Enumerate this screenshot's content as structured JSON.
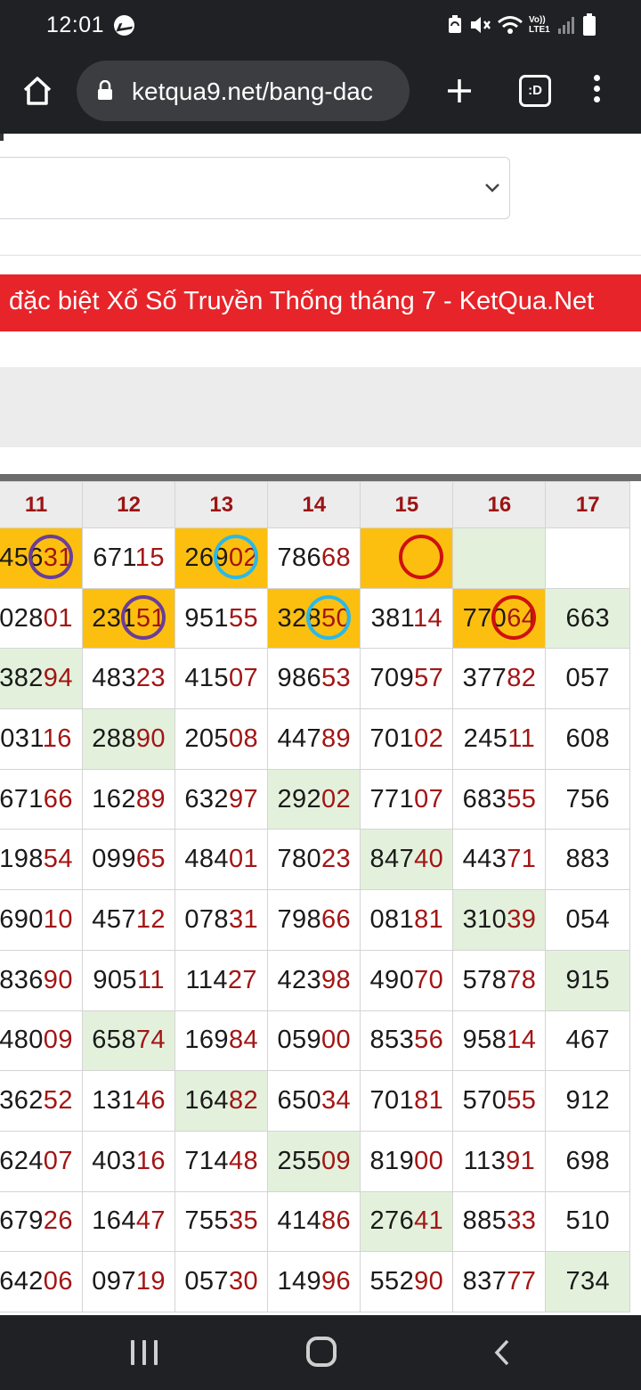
{
  "status_bar": {
    "time": "12:01",
    "volte_label": "Vo)) LTE1",
    "icons": [
      "messenger-icon",
      "sync-icon",
      "mute-icon",
      "wifi-icon",
      "signal-icon",
      "battery-icon"
    ]
  },
  "browser": {
    "url": "ketqua9.net/bang-dac",
    "tab_count_label": ":D",
    "icons": [
      "home-icon",
      "lock-icon",
      "plus-icon",
      "tabs-icon",
      "more-vert-icon"
    ]
  },
  "page": {
    "title": "đặc biệt Xổ Số Truyền Thống tháng 7 - KetQua.Net",
    "colors": {
      "banner": "#e62429",
      "highlight_orange": "#fcbf10",
      "highlight_green": "#e3f1dc",
      "tail_digits": "#a31515",
      "ring_purple": "#6a3d9a",
      "ring_cyan": "#29b9e8",
      "ring_red": "#cf1010"
    }
  },
  "table": {
    "headers": [
      "11",
      "12",
      "13",
      "14",
      "15",
      "16",
      "17"
    ],
    "rows": [
      [
        {
          "head": "456",
          "tail": "31",
          "hl": "orange",
          "ring": "purple"
        },
        {
          "head": "671",
          "tail": "15",
          "hl": "white",
          "ring": ""
        },
        {
          "head": "269",
          "tail": "02",
          "hl": "orange",
          "ring": "cyan"
        },
        {
          "head": "786",
          "tail": "68",
          "hl": "white",
          "ring": ""
        },
        {
          "head": "",
          "tail": "",
          "hl": "orange",
          "ring": "red"
        },
        {
          "head": "",
          "tail": "",
          "hl": "green",
          "ring": ""
        },
        {
          "head": "",
          "tail": "",
          "hl": "white",
          "ring": ""
        }
      ],
      [
        {
          "head": "028",
          "tail": "01",
          "hl": "",
          "ring": ""
        },
        {
          "head": "231",
          "tail": "51",
          "hl": "orange",
          "ring": "purple"
        },
        {
          "head": "951",
          "tail": "55",
          "hl": "",
          "ring": ""
        },
        {
          "head": "328",
          "tail": "50",
          "hl": "orange",
          "ring": "cyan"
        },
        {
          "head": "381",
          "tail": "14",
          "hl": "",
          "ring": ""
        },
        {
          "head": "770",
          "tail": "64",
          "hl": "orange",
          "ring": "red"
        },
        {
          "head": "663",
          "tail": "",
          "hl": "green",
          "ring": ""
        }
      ],
      [
        {
          "head": "382",
          "tail": "94",
          "hl": "green",
          "ring": ""
        },
        {
          "head": "483",
          "tail": "23",
          "hl": "",
          "ring": ""
        },
        {
          "head": "415",
          "tail": "07",
          "hl": "",
          "ring": ""
        },
        {
          "head": "986",
          "tail": "53",
          "hl": "",
          "ring": ""
        },
        {
          "head": "709",
          "tail": "57",
          "hl": "",
          "ring": ""
        },
        {
          "head": "377",
          "tail": "82",
          "hl": "",
          "ring": ""
        },
        {
          "head": "057",
          "tail": "",
          "hl": "",
          "ring": ""
        }
      ],
      [
        {
          "head": "031",
          "tail": "16",
          "hl": "",
          "ring": ""
        },
        {
          "head": "288",
          "tail": "90",
          "hl": "green",
          "ring": ""
        },
        {
          "head": "205",
          "tail": "08",
          "hl": "",
          "ring": ""
        },
        {
          "head": "447",
          "tail": "89",
          "hl": "",
          "ring": ""
        },
        {
          "head": "701",
          "tail": "02",
          "hl": "",
          "ring": ""
        },
        {
          "head": "245",
          "tail": "11",
          "hl": "",
          "ring": ""
        },
        {
          "head": "608",
          "tail": "",
          "hl": "",
          "ring": ""
        }
      ],
      [
        {
          "head": "671",
          "tail": "66",
          "hl": "",
          "ring": ""
        },
        {
          "head": "162",
          "tail": "89",
          "hl": "",
          "ring": ""
        },
        {
          "head": "632",
          "tail": "97",
          "hl": "",
          "ring": ""
        },
        {
          "head": "292",
          "tail": "02",
          "hl": "green",
          "ring": ""
        },
        {
          "head": "771",
          "tail": "07",
          "hl": "",
          "ring": ""
        },
        {
          "head": "683",
          "tail": "55",
          "hl": "",
          "ring": ""
        },
        {
          "head": "756",
          "tail": "",
          "hl": "",
          "ring": ""
        }
      ],
      [
        {
          "head": "198",
          "tail": "54",
          "hl": "",
          "ring": ""
        },
        {
          "head": "099",
          "tail": "65",
          "hl": "",
          "ring": ""
        },
        {
          "head": "484",
          "tail": "01",
          "hl": "",
          "ring": ""
        },
        {
          "head": "780",
          "tail": "23",
          "hl": "",
          "ring": ""
        },
        {
          "head": "847",
          "tail": "40",
          "hl": "green",
          "ring": ""
        },
        {
          "head": "443",
          "tail": "71",
          "hl": "",
          "ring": ""
        },
        {
          "head": "883",
          "tail": "",
          "hl": "",
          "ring": ""
        }
      ],
      [
        {
          "head": "690",
          "tail": "10",
          "hl": "",
          "ring": ""
        },
        {
          "head": "457",
          "tail": "12",
          "hl": "",
          "ring": ""
        },
        {
          "head": "078",
          "tail": "31",
          "hl": "",
          "ring": ""
        },
        {
          "head": "798",
          "tail": "66",
          "hl": "",
          "ring": ""
        },
        {
          "head": "081",
          "tail": "81",
          "hl": "",
          "ring": ""
        },
        {
          "head": "310",
          "tail": "39",
          "hl": "green",
          "ring": ""
        },
        {
          "head": "054",
          "tail": "",
          "hl": "",
          "ring": ""
        }
      ],
      [
        {
          "head": "836",
          "tail": "90",
          "hl": "",
          "ring": ""
        },
        {
          "head": "905",
          "tail": "11",
          "hl": "",
          "ring": ""
        },
        {
          "head": "114",
          "tail": "27",
          "hl": "",
          "ring": ""
        },
        {
          "head": "423",
          "tail": "98",
          "hl": "",
          "ring": ""
        },
        {
          "head": "490",
          "tail": "70",
          "hl": "",
          "ring": ""
        },
        {
          "head": "578",
          "tail": "78",
          "hl": "",
          "ring": ""
        },
        {
          "head": "915",
          "tail": "",
          "hl": "green",
          "ring": ""
        }
      ],
      [
        {
          "head": "480",
          "tail": "09",
          "hl": "",
          "ring": ""
        },
        {
          "head": "658",
          "tail": "74",
          "hl": "green",
          "ring": ""
        },
        {
          "head": "169",
          "tail": "84",
          "hl": "",
          "ring": ""
        },
        {
          "head": "059",
          "tail": "00",
          "hl": "",
          "ring": ""
        },
        {
          "head": "853",
          "tail": "56",
          "hl": "",
          "ring": ""
        },
        {
          "head": "958",
          "tail": "14",
          "hl": "",
          "ring": ""
        },
        {
          "head": "467",
          "tail": "",
          "hl": "",
          "ring": ""
        }
      ],
      [
        {
          "head": "362",
          "tail": "52",
          "hl": "",
          "ring": ""
        },
        {
          "head": "131",
          "tail": "46",
          "hl": "",
          "ring": ""
        },
        {
          "head": "164",
          "tail": "82",
          "hl": "green",
          "ring": ""
        },
        {
          "head": "650",
          "tail": "34",
          "hl": "",
          "ring": ""
        },
        {
          "head": "701",
          "tail": "81",
          "hl": "",
          "ring": ""
        },
        {
          "head": "570",
          "tail": "55",
          "hl": "",
          "ring": ""
        },
        {
          "head": "912",
          "tail": "",
          "hl": "",
          "ring": ""
        }
      ],
      [
        {
          "head": "624",
          "tail": "07",
          "hl": "",
          "ring": ""
        },
        {
          "head": "403",
          "tail": "16",
          "hl": "",
          "ring": ""
        },
        {
          "head": "714",
          "tail": "48",
          "hl": "",
          "ring": ""
        },
        {
          "head": "255",
          "tail": "09",
          "hl": "green",
          "ring": ""
        },
        {
          "head": "819",
          "tail": "00",
          "hl": "",
          "ring": ""
        },
        {
          "head": "113",
          "tail": "91",
          "hl": "",
          "ring": ""
        },
        {
          "head": "698",
          "tail": "",
          "hl": "",
          "ring": ""
        }
      ],
      [
        {
          "head": "679",
          "tail": "26",
          "hl": "",
          "ring": ""
        },
        {
          "head": "164",
          "tail": "47",
          "hl": "",
          "ring": ""
        },
        {
          "head": "755",
          "tail": "35",
          "hl": "",
          "ring": ""
        },
        {
          "head": "414",
          "tail": "86",
          "hl": "",
          "ring": ""
        },
        {
          "head": "276",
          "tail": "41",
          "hl": "green",
          "ring": ""
        },
        {
          "head": "885",
          "tail": "33",
          "hl": "",
          "ring": ""
        },
        {
          "head": "510",
          "tail": "",
          "hl": "",
          "ring": ""
        }
      ],
      [
        {
          "head": "642",
          "tail": "06",
          "hl": "",
          "ring": ""
        },
        {
          "head": "097",
          "tail": "19",
          "hl": "",
          "ring": ""
        },
        {
          "head": "057",
          "tail": "30",
          "hl": "",
          "ring": ""
        },
        {
          "head": "149",
          "tail": "96",
          "hl": "",
          "ring": ""
        },
        {
          "head": "552",
          "tail": "90",
          "hl": "",
          "ring": ""
        },
        {
          "head": "837",
          "tail": "77",
          "hl": "",
          "ring": ""
        },
        {
          "head": "734",
          "tail": "",
          "hl": "green",
          "ring": ""
        }
      ]
    ]
  },
  "nav_bar": {
    "icons": [
      "recent-apps-icon",
      "home-nav-icon",
      "back-icon"
    ]
  }
}
